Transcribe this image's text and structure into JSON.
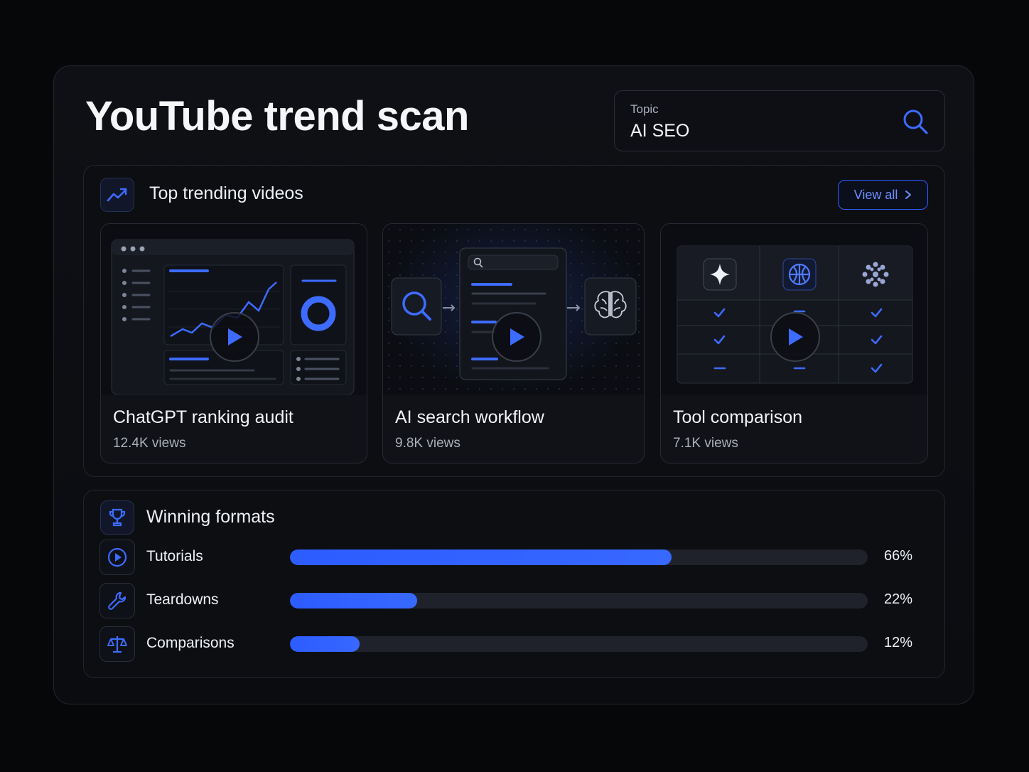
{
  "header": {
    "title": "YouTube trend scan"
  },
  "search": {
    "label": "Topic",
    "value": "AI SEO",
    "icon": "search-icon"
  },
  "trending": {
    "title": "Top trending videos",
    "icon": "trending-up-icon",
    "view_all": "View all",
    "videos": [
      {
        "title": "ChatGPT ranking audit",
        "views": "12.4K views"
      },
      {
        "title": "AI search workflow",
        "views": "9.8K views"
      },
      {
        "title": "Tool comparison",
        "views": "7.1K views"
      }
    ]
  },
  "formats": {
    "title": "Winning formats",
    "icon": "trophy-icon",
    "items": [
      {
        "label": "Tutorials",
        "percent_label": "66%",
        "value": 0.66,
        "icon": "play-circle-icon"
      },
      {
        "label": "Teardowns",
        "percent_label": "22%",
        "value": 0.22,
        "icon": "wrench-icon"
      },
      {
        "label": "Comparisons",
        "percent_label": "12%",
        "value": 0.12,
        "icon": "scale-icon"
      }
    ]
  },
  "colors": {
    "accent": "#2f5eff",
    "background": "#060709",
    "panel": "#0e1015"
  }
}
